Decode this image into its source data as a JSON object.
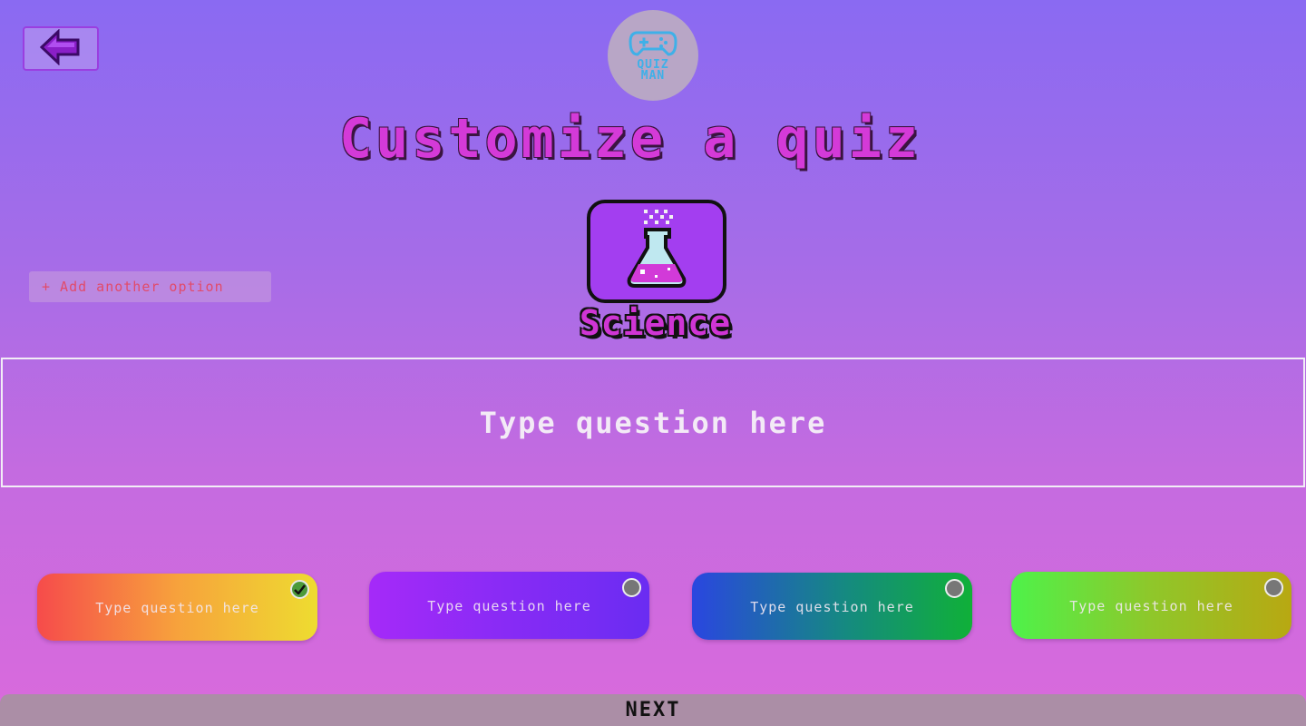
{
  "logo": {
    "text": "QUIZ\nMAN",
    "icon": "gamepad-icon"
  },
  "header": {
    "title": "Customize a quiz",
    "back_icon": "arrow-left-icon"
  },
  "add_option": {
    "label": "+ Add another option"
  },
  "category": {
    "name": "Science",
    "icon": "flask-icon"
  },
  "question": {
    "placeholder": "Type question here",
    "value": ""
  },
  "answers": [
    {
      "placeholder": "Type question here",
      "selected": true
    },
    {
      "placeholder": "Type question here",
      "selected": false
    },
    {
      "placeholder": "Type question here",
      "selected": false
    },
    {
      "placeholder": "Type question here",
      "selected": false
    }
  ],
  "footer": {
    "next_label": "NEXT"
  },
  "colors": {
    "title": "#d43ad8",
    "selected_radio": "#4c9a3a",
    "next_bar": "#ab8ea6"
  }
}
